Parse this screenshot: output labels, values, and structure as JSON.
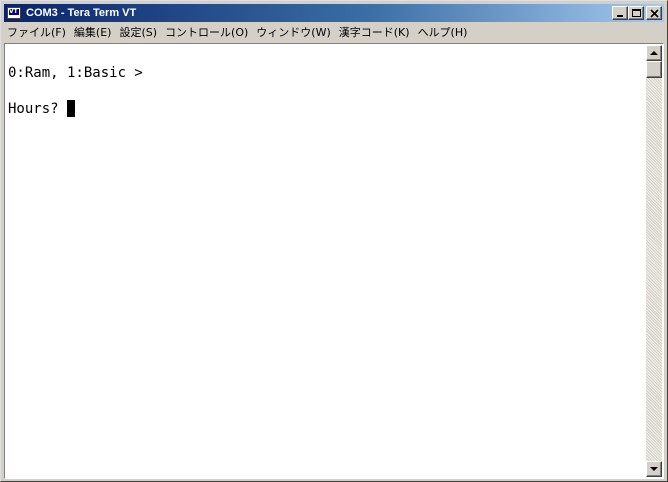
{
  "window": {
    "title": "COM3 - Tera Term VT",
    "app_icon": "vt-terminal-icon",
    "controls": [
      "minimize-icon",
      "maximize-icon",
      "close-icon"
    ]
  },
  "menu": {
    "items": [
      {
        "label": "ファイル(F)"
      },
      {
        "label": "編集(E)"
      },
      {
        "label": "設定(S)"
      },
      {
        "label": "コントロール(O)"
      },
      {
        "label": "ウィンドウ(W)"
      },
      {
        "label": "漢字コード(K)"
      },
      {
        "label": "ヘルプ(H)"
      }
    ]
  },
  "terminal": {
    "lines": [
      "0:Ram, 1:Basic >",
      "Hours? "
    ],
    "background": "#ffffff",
    "foreground": "#000000"
  },
  "colors": {
    "titlebar_start": "#0a246a",
    "titlebar_end": "#a6caf0",
    "chrome": "#d4d0c8"
  }
}
